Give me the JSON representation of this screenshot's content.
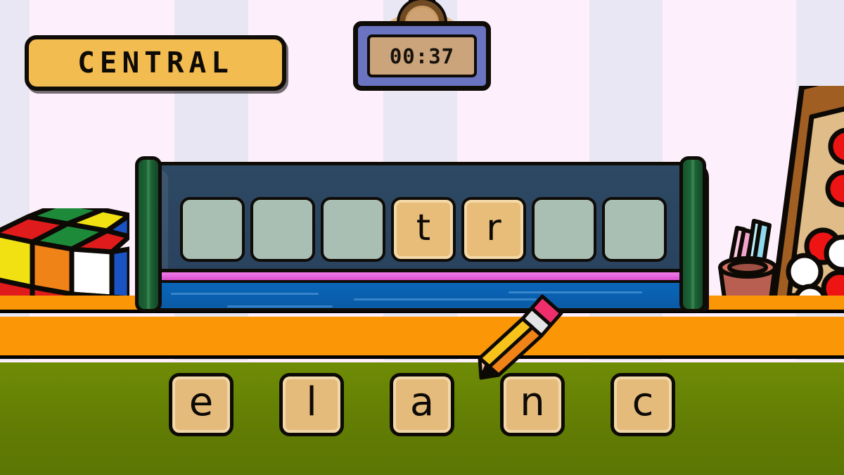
{
  "app": {
    "title_badge": "CENTRAL",
    "timer": "00:37"
  },
  "colors": {
    "badge_bg": "#f3bc51",
    "outline": "#0f0b07",
    "board_panel": "#2d4963",
    "board_blue": "#0a62b0",
    "board_magenta": "#e866dd",
    "post_green": "#1d6335",
    "slot_empty": "#aabfb4",
    "tile_tan": "#e5bb7c",
    "tile_inner": "#f2d7a8",
    "desk_orange": "#fb9607",
    "floor_green": "#6f8c06",
    "wall_pink": "#fdeffb",
    "wall_lavender": "#eae7f4",
    "timer_frame": "#6a74c0",
    "timer_screen": "#cba47c",
    "pencil_body": "#f7c21a",
    "pencil_eraser": "#ef2f6b"
  },
  "board": {
    "slots": [
      {
        "letter": "",
        "filled": false
      },
      {
        "letter": "",
        "filled": false
      },
      {
        "letter": "",
        "filled": false
      },
      {
        "letter": "t",
        "filled": true
      },
      {
        "letter": "r",
        "filled": true
      },
      {
        "letter": "",
        "filled": false
      },
      {
        "letter": "",
        "filled": false
      }
    ]
  },
  "tray": {
    "tiles": [
      {
        "letter": "e"
      },
      {
        "letter": "l"
      },
      {
        "letter": "a"
      },
      {
        "letter": "n"
      },
      {
        "letter": "c"
      }
    ]
  },
  "decor": {
    "cube_name": "rubiks-cube",
    "pegboard_name": "peg-board-game",
    "chalkpot_name": "chalk-pot",
    "pencil_name": "pencil-cursor"
  }
}
